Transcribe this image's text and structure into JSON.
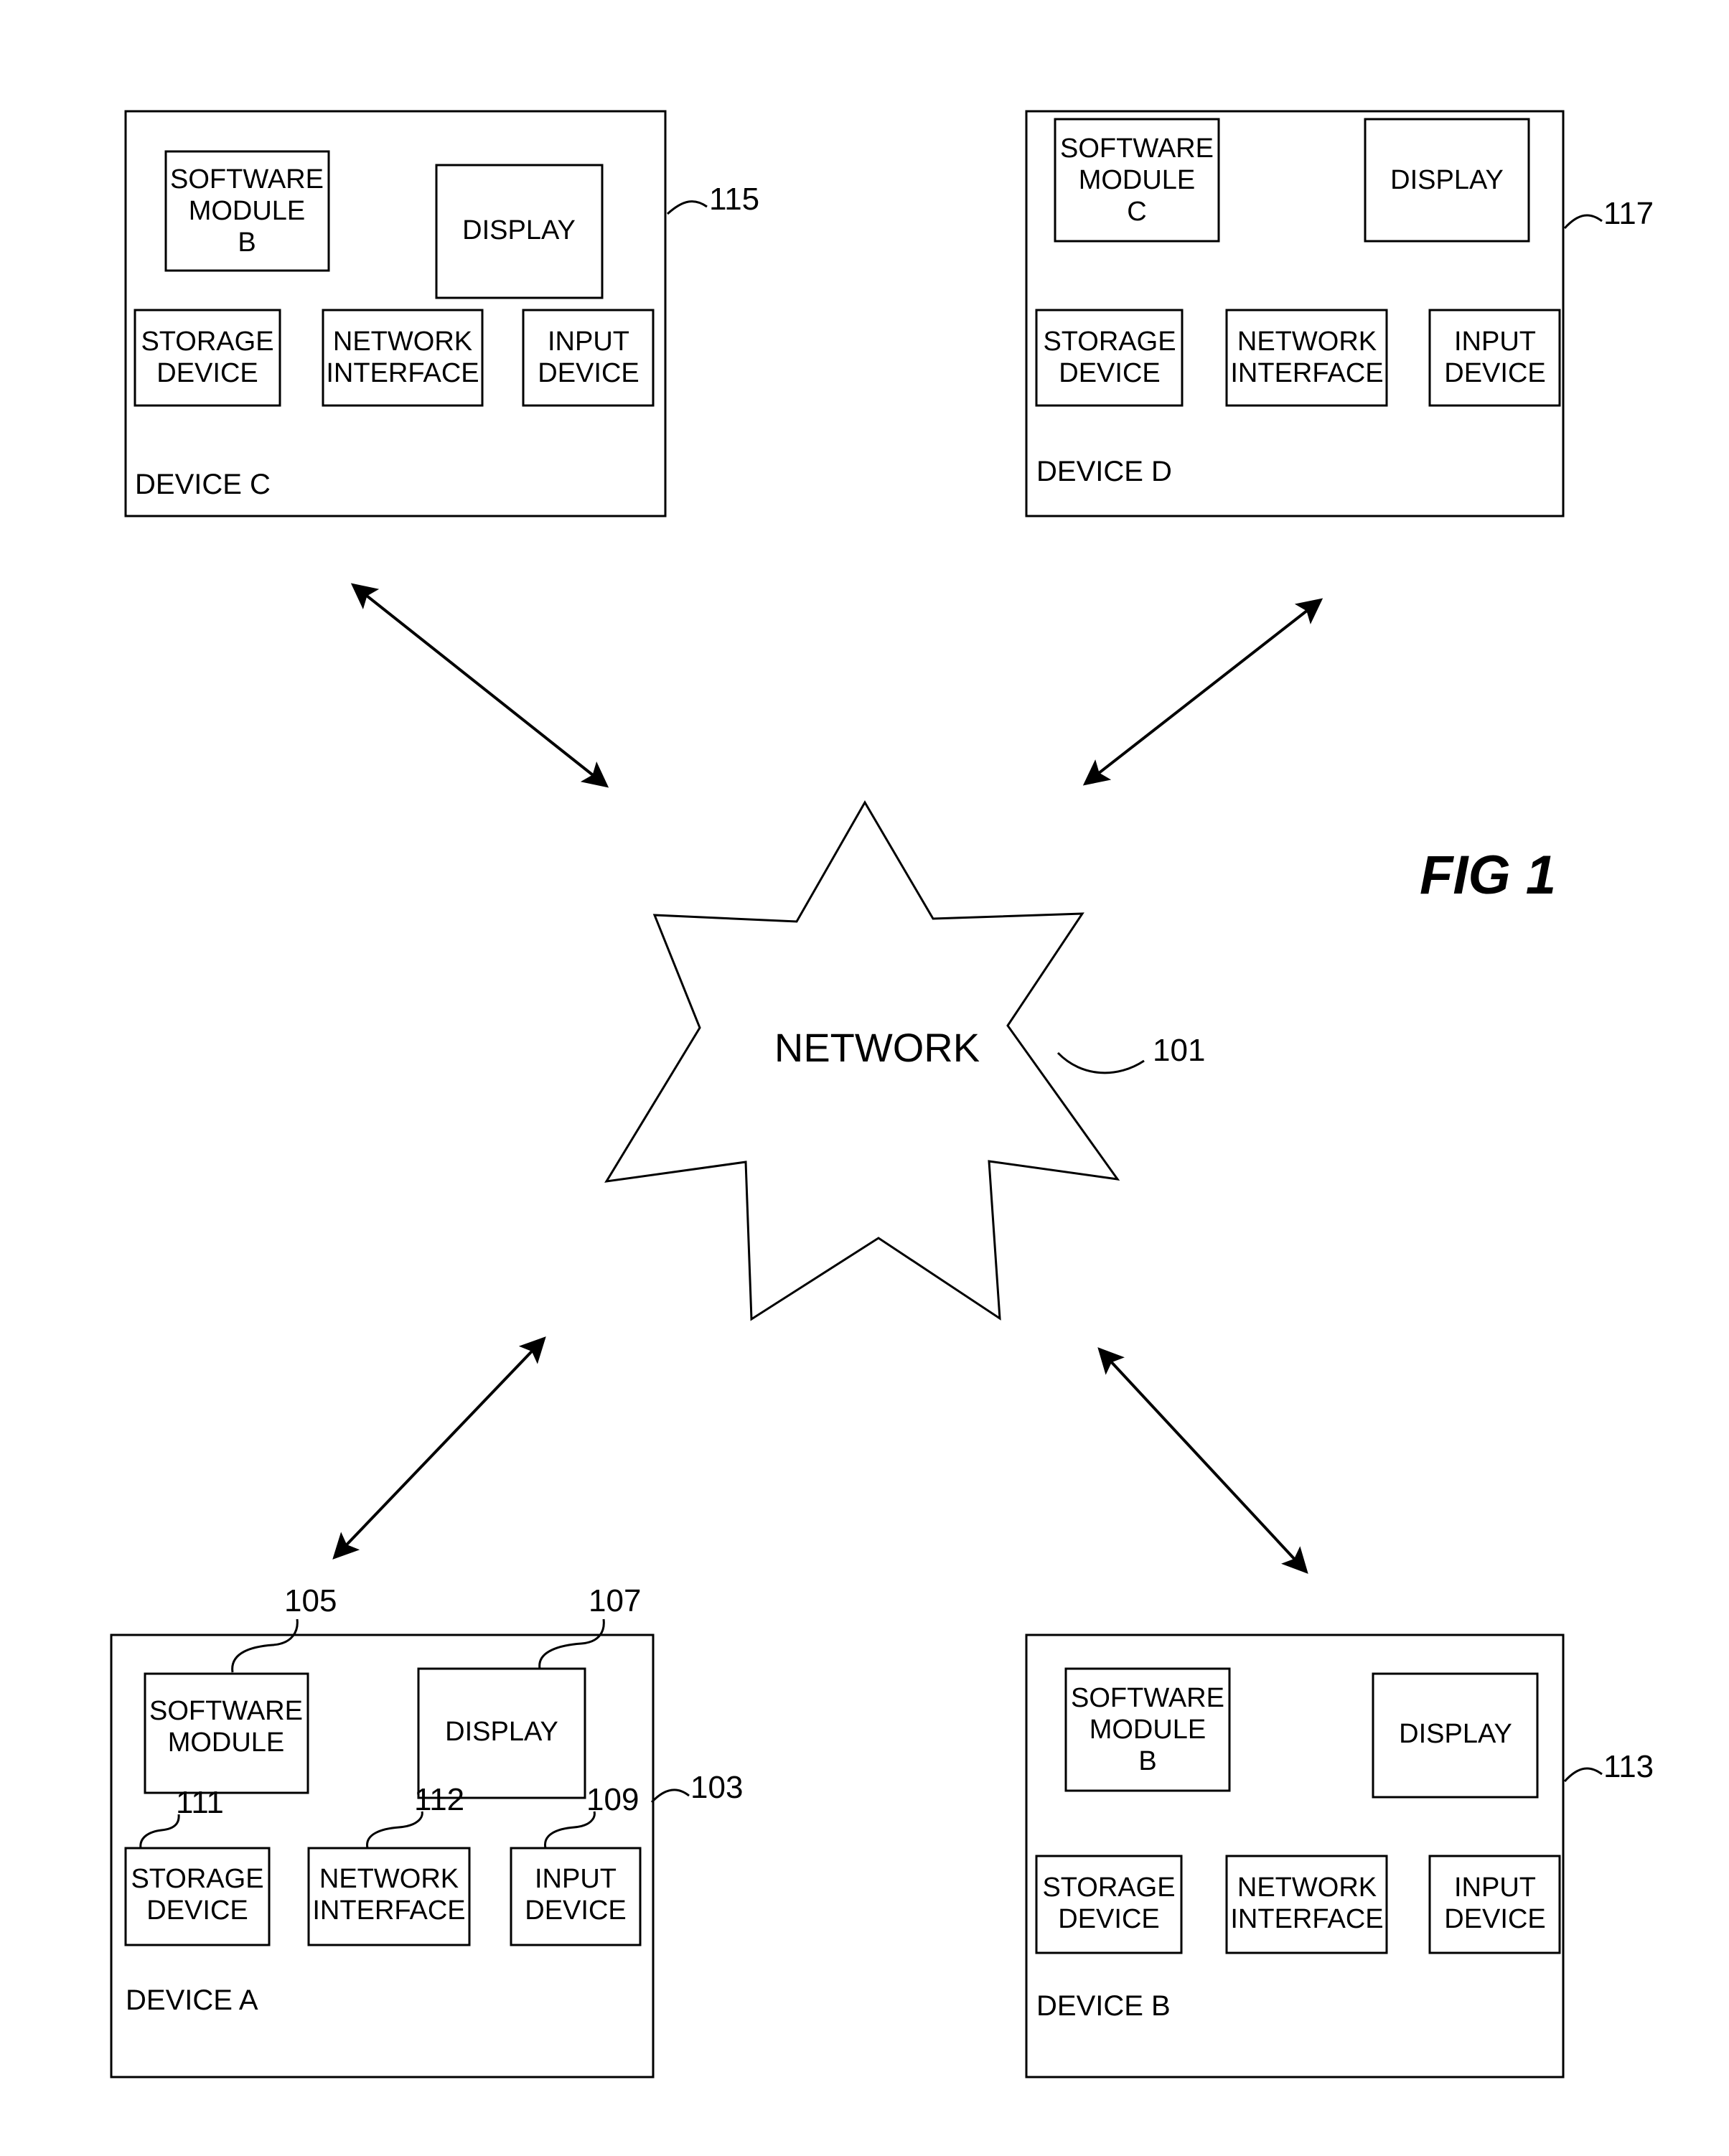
{
  "figure": {
    "label": "FIG 1",
    "type": "patent-network-block-diagram"
  },
  "network": {
    "label": "NETWORK",
    "ref": "101"
  },
  "component_labels": {
    "software_module": "SOFTWARE\nMODULE",
    "display": "DISPLAY",
    "storage_device": "STORAGE\nDEVICE",
    "network_interface": "NETWORK\nINTERFACE",
    "input_device": "INPUT\nDEVICE"
  },
  "devices": [
    {
      "id": "device-c",
      "name": "DEVICE C",
      "ref": "115",
      "position": "top-left",
      "components": [
        {
          "name": "software-module",
          "line1": "SOFTWARE",
          "line2": "MODULE",
          "line3": "B",
          "ref": ""
        },
        {
          "name": "display",
          "line1": "DISPLAY",
          "line2": "",
          "line3": "",
          "ref": ""
        },
        {
          "name": "storage-device",
          "line1": "STORAGE",
          "line2": "DEVICE",
          "line3": "",
          "ref": ""
        },
        {
          "name": "network-interface",
          "line1": "NETWORK",
          "line2": "INTERFACE",
          "line3": "",
          "ref": ""
        },
        {
          "name": "input-device",
          "line1": "INPUT",
          "line2": "DEVICE",
          "line3": "",
          "ref": ""
        }
      ]
    },
    {
      "id": "device-d",
      "name": "DEVICE D",
      "ref": "117",
      "position": "top-right",
      "components": [
        {
          "name": "software-module",
          "line1": "SOFTWARE",
          "line2": "MODULE",
          "line3": "C",
          "ref": ""
        },
        {
          "name": "display",
          "line1": "DISPLAY",
          "line2": "",
          "line3": "",
          "ref": ""
        },
        {
          "name": "storage-device",
          "line1": "STORAGE",
          "line2": "DEVICE",
          "line3": "",
          "ref": ""
        },
        {
          "name": "network-interface",
          "line1": "NETWORK",
          "line2": "INTERFACE",
          "line3": "",
          "ref": ""
        },
        {
          "name": "input-device",
          "line1": "INPUT",
          "line2": "DEVICE",
          "line3": "",
          "ref": ""
        }
      ]
    },
    {
      "id": "device-a",
      "name": "DEVICE A",
      "ref": "103",
      "position": "bottom-left",
      "components": [
        {
          "name": "software-module",
          "line1": "SOFTWARE",
          "line2": "MODULE",
          "line3": "",
          "ref": "105"
        },
        {
          "name": "display",
          "line1": "DISPLAY",
          "line2": "",
          "line3": "",
          "ref": "107"
        },
        {
          "name": "storage-device",
          "line1": "STORAGE",
          "line2": "DEVICE",
          "line3": "",
          "ref": "111"
        },
        {
          "name": "network-interface",
          "line1": "NETWORK",
          "line2": "INTERFACE",
          "line3": "",
          "ref": "112"
        },
        {
          "name": "input-device",
          "line1": "INPUT",
          "line2": "DEVICE",
          "line3": "",
          "ref": "109"
        }
      ]
    },
    {
      "id": "device-b",
      "name": "DEVICE B",
      "ref": "113",
      "position": "bottom-right",
      "components": [
        {
          "name": "software-module",
          "line1": "SOFTWARE",
          "line2": "MODULE",
          "line3": "B",
          "ref": ""
        },
        {
          "name": "display",
          "line1": "DISPLAY",
          "line2": "",
          "line3": "",
          "ref": ""
        },
        {
          "name": "storage-device",
          "line1": "STORAGE",
          "line2": "DEVICE",
          "line3": "",
          "ref": ""
        },
        {
          "name": "network-interface",
          "line1": "NETWORK",
          "line2": "INTERFACE",
          "line3": "",
          "ref": ""
        },
        {
          "name": "input-device",
          "line1": "INPUT",
          "line2": "DEVICE",
          "line3": "",
          "ref": ""
        }
      ]
    }
  ],
  "connections": [
    {
      "from": "network",
      "to": "device-c",
      "style": "double-arrow"
    },
    {
      "from": "network",
      "to": "device-d",
      "style": "double-arrow"
    },
    {
      "from": "network",
      "to": "device-a",
      "style": "double-arrow"
    },
    {
      "from": "network",
      "to": "device-b",
      "style": "double-arrow"
    }
  ],
  "colors": {
    "stroke": "#000000",
    "background": "#ffffff"
  }
}
